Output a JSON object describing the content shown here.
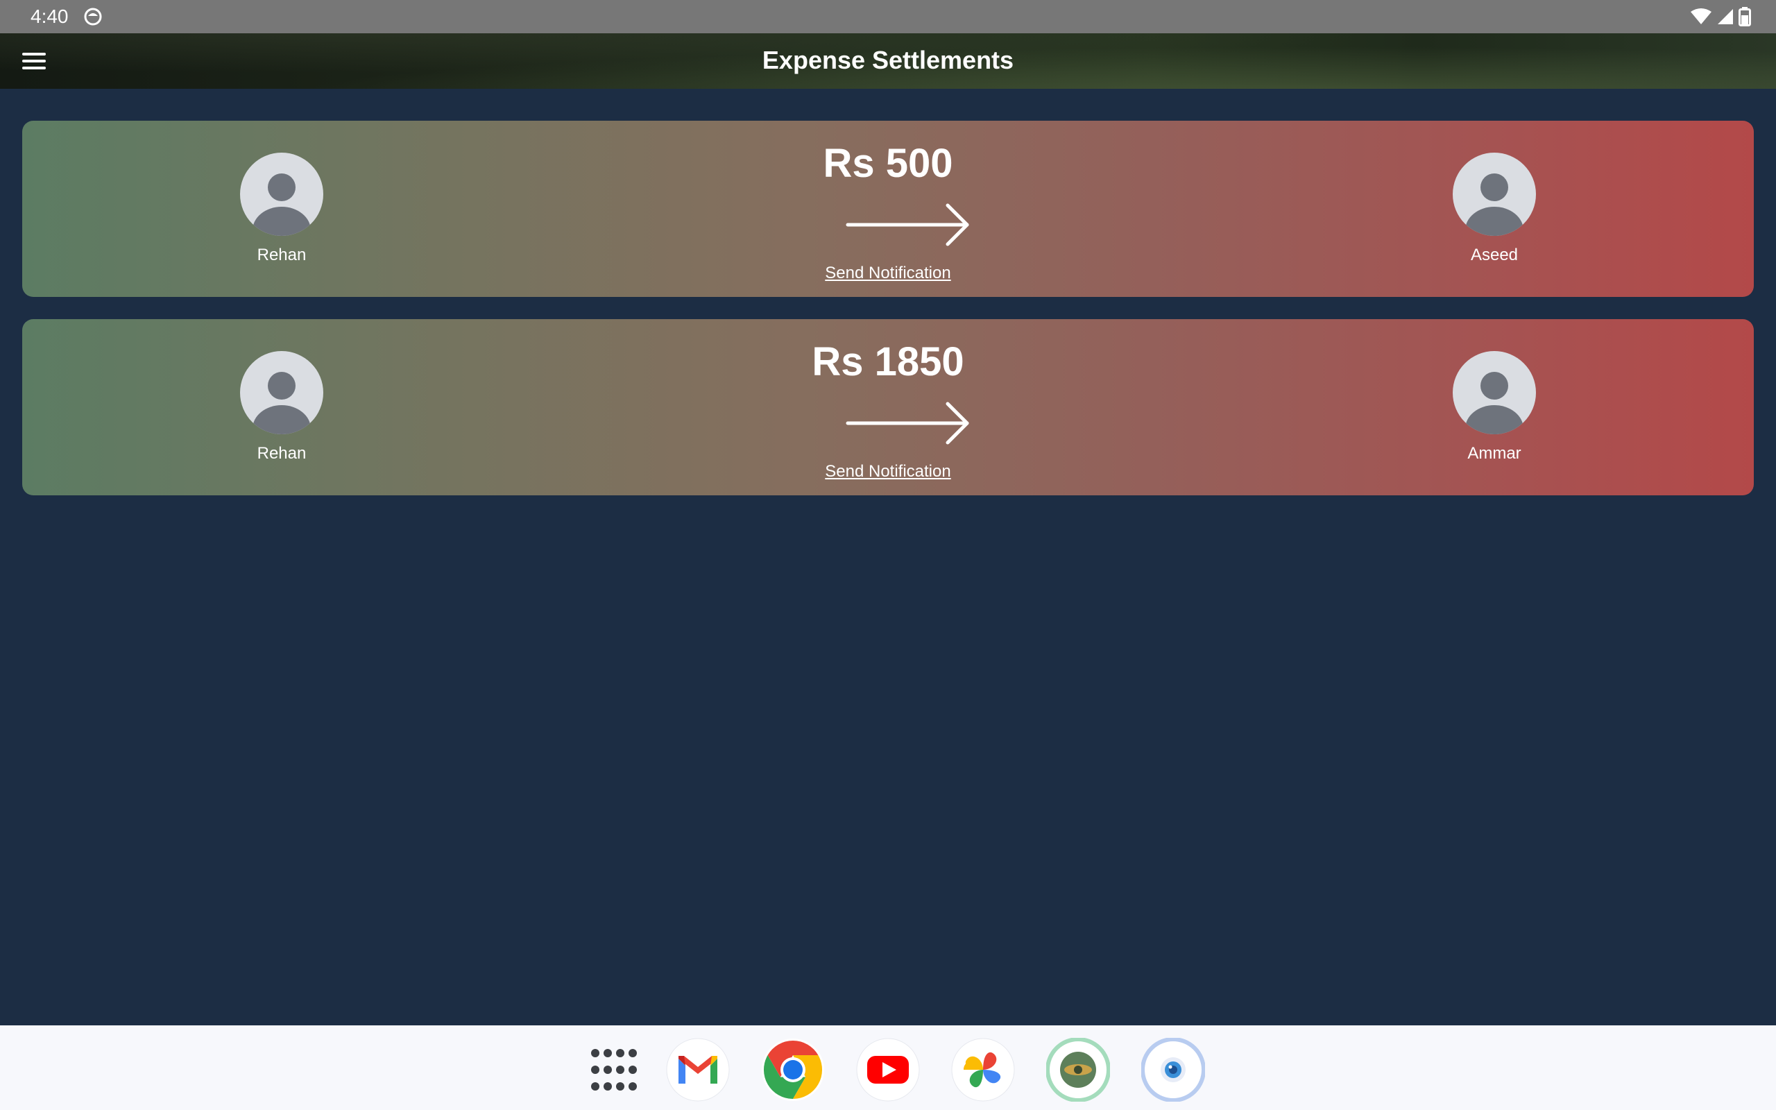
{
  "status_bar": {
    "time": "4:40"
  },
  "app_bar": {
    "title": "Expense Settlements"
  },
  "settlements": [
    {
      "from": "Rehan",
      "to": "Aseed",
      "amount": "Rs 500",
      "action": "Send Notification"
    },
    {
      "from": "Rehan",
      "to": "Ammar",
      "amount": "Rs 1850",
      "action": "Send Notification"
    }
  ],
  "dock": {
    "icons": [
      "apps-grid-icon",
      "gmail-icon",
      "chrome-icon",
      "youtube-icon",
      "photos-icon",
      "game-app-icon",
      "camera-app-icon"
    ]
  },
  "colors": {
    "background": "#1c2d44",
    "card_gradient_start": "#5c7c63",
    "card_gradient_end": "#b34949",
    "status_bar": "#777777",
    "avatar_bg": "#dadde2",
    "avatar_fg": "#6e737c"
  }
}
